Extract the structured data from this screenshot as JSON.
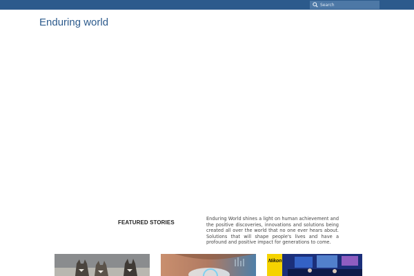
{
  "header": {
    "search_placeholder": "Search"
  },
  "site": {
    "title": "Enduring world"
  },
  "featured": {
    "label": "FEATURED STORIES",
    "intro": "Enduring World shines a light on human achievement and the positive discoveries, innovations and solutions being created all over the world that no one ever hears about. Solutions that will shape people's lives and have a profound and positive impact for generations to come."
  },
  "cards": [
    {
      "image": "wolves-photo"
    },
    {
      "image": "eye-technology-photo"
    },
    {
      "image": "nikon-event-photo",
      "logo_text": "Nikon"
    }
  ],
  "colors": {
    "topbar": "#2c5a8c",
    "title": "#2c5a8c"
  }
}
